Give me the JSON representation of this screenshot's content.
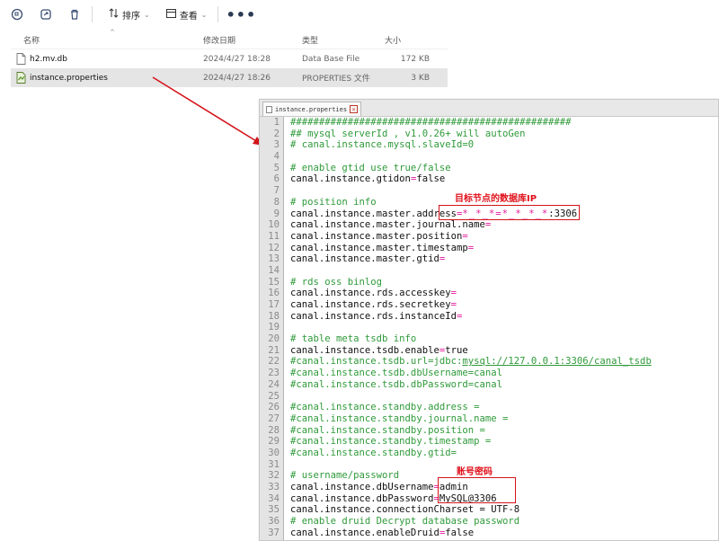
{
  "toolbar": {
    "icons": [
      "copy-icon",
      "share-icon",
      "delete-icon"
    ],
    "sort_label": "排序",
    "view_label": "查看",
    "more_label": "•••"
  },
  "filelist": {
    "headers": {
      "name": "名称",
      "date": "修改日期",
      "type": "类型",
      "size": "大小"
    },
    "rows": [
      {
        "name": "h2.mv.db",
        "date": "2024/4/27 18:28",
        "type": "Data Base File",
        "size": "172 KB",
        "selected": false
      },
      {
        "name": "instance.properties",
        "date": "2024/4/27 18:26",
        "type": "PROPERTIES 文件",
        "size": "3 KB",
        "selected": true
      }
    ]
  },
  "editor": {
    "tab_label": "instance.properties",
    "lines": [
      {
        "n": "1",
        "parts": [
          {
            "t": "#################################################",
            "c": "comment"
          }
        ]
      },
      {
        "n": "2",
        "parts": [
          {
            "t": "## mysql serverId , v1.0.26+ will autoGen",
            "c": "comment"
          }
        ]
      },
      {
        "n": "3",
        "parts": [
          {
            "t": "# canal.instance.mysql.slaveId=0",
            "c": "comment"
          }
        ]
      },
      {
        "n": "4",
        "parts": []
      },
      {
        "n": "5",
        "parts": [
          {
            "t": "# enable gtid use true/false",
            "c": "comment"
          }
        ]
      },
      {
        "n": "6",
        "parts": [
          {
            "t": "canal.instance.gtidon",
            "c": "key"
          },
          {
            "t": "=",
            "c": "eq"
          },
          {
            "t": "false",
            "c": "val"
          }
        ]
      },
      {
        "n": "7",
        "parts": []
      },
      {
        "n": "8",
        "parts": [
          {
            "t": "# position info",
            "c": "comment"
          }
        ]
      },
      {
        "n": "9",
        "parts": [
          {
            "t": "canal.instance.master.address",
            "c": "key"
          },
          {
            "t": "=",
            "c": "eq"
          },
          {
            "t": "*_*_*=*_*_*_*",
            "c": "redact"
          },
          {
            "t": ":3306",
            "c": "val"
          }
        ]
      },
      {
        "n": "10",
        "parts": [
          {
            "t": "canal.instance.master.journal.name",
            "c": "key"
          },
          {
            "t": "=",
            "c": "eq"
          }
        ]
      },
      {
        "n": "11",
        "parts": [
          {
            "t": "canal.instance.master.position",
            "c": "key"
          },
          {
            "t": "=",
            "c": "eq"
          }
        ]
      },
      {
        "n": "12",
        "parts": [
          {
            "t": "canal.instance.master.timestamp",
            "c": "key"
          },
          {
            "t": "=",
            "c": "eq"
          }
        ]
      },
      {
        "n": "13",
        "parts": [
          {
            "t": "canal.instance.master.gtid",
            "c": "key"
          },
          {
            "t": "=",
            "c": "eq"
          }
        ]
      },
      {
        "n": "14",
        "parts": []
      },
      {
        "n": "15",
        "parts": [
          {
            "t": "# rds oss binlog",
            "c": "comment"
          }
        ]
      },
      {
        "n": "16",
        "parts": [
          {
            "t": "canal.instance.rds.accesskey",
            "c": "key"
          },
          {
            "t": "=",
            "c": "eq"
          }
        ]
      },
      {
        "n": "17",
        "parts": [
          {
            "t": "canal.instance.rds.secretkey",
            "c": "key"
          },
          {
            "t": "=",
            "c": "eq"
          }
        ]
      },
      {
        "n": "18",
        "parts": [
          {
            "t": "canal.instance.rds.instanceId",
            "c": "key"
          },
          {
            "t": "=",
            "c": "eq"
          }
        ]
      },
      {
        "n": "19",
        "parts": []
      },
      {
        "n": "20",
        "parts": [
          {
            "t": "# table meta tsdb info",
            "c": "comment"
          }
        ]
      },
      {
        "n": "21",
        "parts": [
          {
            "t": "canal.instance.tsdb.enable",
            "c": "key"
          },
          {
            "t": "=",
            "c": "eq"
          },
          {
            "t": "true",
            "c": "val"
          }
        ]
      },
      {
        "n": "22",
        "parts": [
          {
            "t": "#canal.instance.tsdb.url=jdbc:",
            "c": "comment"
          },
          {
            "t": "mysql://127.0.0.1:3306/canal_tsdb",
            "c": "link"
          }
        ]
      },
      {
        "n": "23",
        "parts": [
          {
            "t": "#canal.instance.tsdb.dbUsername=canal",
            "c": "comment"
          }
        ]
      },
      {
        "n": "24",
        "parts": [
          {
            "t": "#canal.instance.tsdb.dbPassword=canal",
            "c": "comment"
          }
        ]
      },
      {
        "n": "25",
        "parts": []
      },
      {
        "n": "26",
        "parts": [
          {
            "t": "#canal.instance.standby.address =",
            "c": "comment"
          }
        ]
      },
      {
        "n": "27",
        "parts": [
          {
            "t": "#canal.instance.standby.journal.name =",
            "c": "comment"
          }
        ]
      },
      {
        "n": "28",
        "parts": [
          {
            "t": "#canal.instance.standby.position =",
            "c": "comment"
          }
        ]
      },
      {
        "n": "29",
        "parts": [
          {
            "t": "#canal.instance.standby.timestamp =",
            "c": "comment"
          }
        ]
      },
      {
        "n": "30",
        "parts": [
          {
            "t": "#canal.instance.standby.gtid=",
            "c": "comment"
          }
        ]
      },
      {
        "n": "31",
        "parts": []
      },
      {
        "n": "32",
        "parts": [
          {
            "t": "# username/password",
            "c": "comment"
          }
        ]
      },
      {
        "n": "33",
        "parts": [
          {
            "t": "canal.instance.dbUsername",
            "c": "key"
          },
          {
            "t": "=",
            "c": "eq"
          },
          {
            "t": "admin",
            "c": "val"
          }
        ]
      },
      {
        "n": "34",
        "parts": [
          {
            "t": "canal.instance.dbPassword",
            "c": "key"
          },
          {
            "t": "=",
            "c": "eq"
          },
          {
            "t": "MySQL@3306",
            "c": "val"
          }
        ]
      },
      {
        "n": "35",
        "parts": [
          {
            "t": "canal.instance.connectionCharset = UTF-8",
            "c": "key"
          }
        ]
      },
      {
        "n": "36",
        "parts": [
          {
            "t": "# enable druid Decrypt database password",
            "c": "comment"
          }
        ]
      },
      {
        "n": "37",
        "parts": [
          {
            "t": "canal.instance.enableDruid",
            "c": "key"
          },
          {
            "t": "=",
            "c": "eq"
          },
          {
            "t": "false",
            "c": "val"
          }
        ]
      }
    ]
  },
  "annotations": {
    "target_ip_label": "目标节点的数据库IP",
    "credentials_label": "账号密码"
  },
  "colors": {
    "accent": "#d4141b",
    "comment": "#2f9a3a",
    "operator": "#e21a9a"
  }
}
